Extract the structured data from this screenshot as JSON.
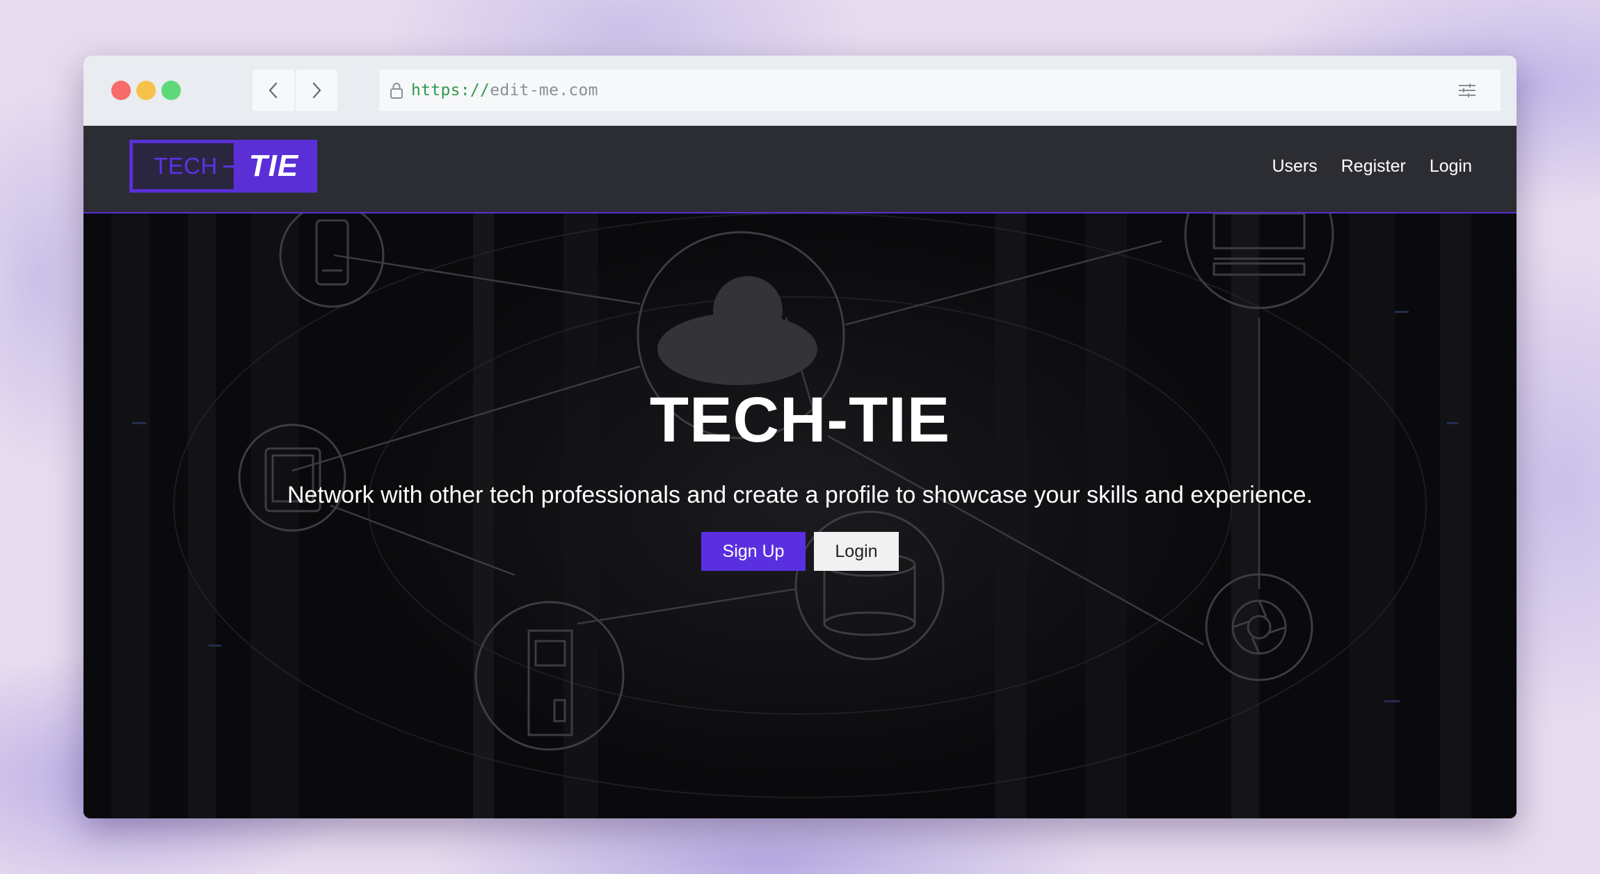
{
  "browser": {
    "url_scheme": "https://",
    "url_host": "edit-me.com"
  },
  "site": {
    "logo": {
      "left_text": "TECH",
      "right_text": "TIE"
    },
    "nav": {
      "links": [
        "Users",
        "Register",
        "Login"
      ]
    },
    "hero": {
      "title": "TECH-TIE",
      "subtitle": "Network with other tech professionals and create a profile to showcase your skills and experience.",
      "primary_button": "Sign Up",
      "secondary_button": "Login"
    }
  },
  "colors": {
    "brand_purple": "#5a2fd6",
    "navbar_bg": "#2c2d33",
    "hero_bg": "#0d0d10"
  },
  "icons": [
    "lock-icon",
    "chevron-left-icon",
    "chevron-right-icon",
    "sliders-icon",
    "cloud-icon",
    "smartphone-icon",
    "tablet-icon",
    "monitor-icon",
    "database-icon",
    "server-icon",
    "camera-shutter-icon"
  ]
}
